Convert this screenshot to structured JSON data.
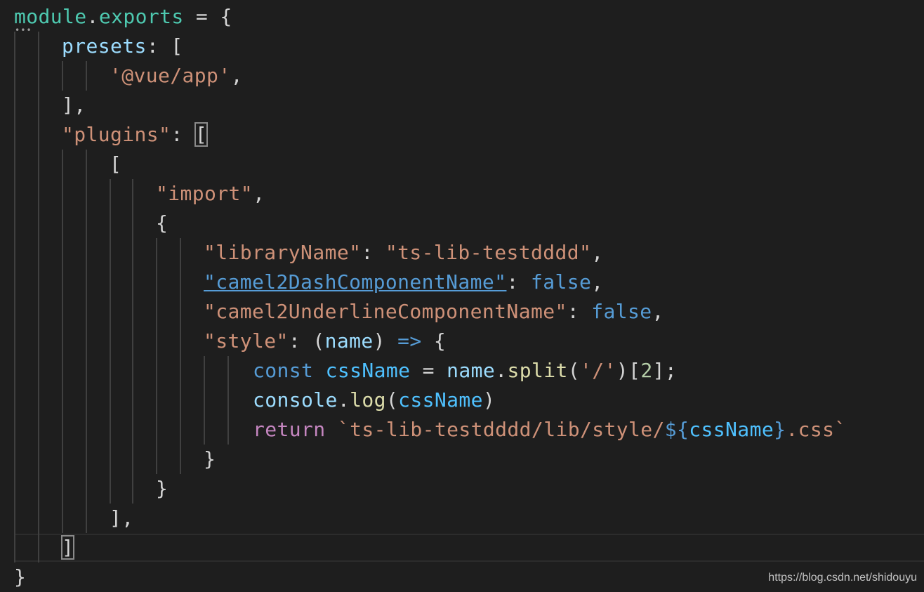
{
  "code_lines": [
    [
      {
        "text": "module",
        "cls": "module"
      },
      {
        "text": ".",
        "cls": "plain"
      },
      {
        "text": "exports",
        "cls": "module"
      },
      {
        "text": " = {",
        "cls": "plain"
      }
    ],
    [
      {
        "text": "presets",
        "cls": "prop"
      },
      {
        "text": ": [",
        "cls": "plain"
      }
    ],
    [
      {
        "text": "'@vue/app'",
        "cls": "string"
      },
      {
        "text": ",",
        "cls": "plain"
      }
    ],
    [
      {
        "text": "],",
        "cls": "plain"
      }
    ],
    [
      {
        "text": "\"plugins\"",
        "cls": "string"
      },
      {
        "text": ": ",
        "cls": "plain"
      },
      {
        "text": "[",
        "cls": "plain bracket-box"
      }
    ],
    [
      {
        "text": "[",
        "cls": "plain"
      }
    ],
    [
      {
        "text": "\"import\"",
        "cls": "string"
      },
      {
        "text": ",",
        "cls": "plain"
      }
    ],
    [
      {
        "text": "{",
        "cls": "plain"
      }
    ],
    [
      {
        "text": "\"libraryName\"",
        "cls": "string"
      },
      {
        "text": ": ",
        "cls": "plain"
      },
      {
        "text": "\"ts-lib-testdddd\"",
        "cls": "string"
      },
      {
        "text": ",",
        "cls": "plain"
      }
    ],
    [
      {
        "text": "\"camel2DashComponentName\"",
        "cls": "link"
      },
      {
        "text": ": ",
        "cls": "plain"
      },
      {
        "text": "false",
        "cls": "bool"
      },
      {
        "text": ",",
        "cls": "plain"
      }
    ],
    [
      {
        "text": "\"camel2UnderlineComponentName\"",
        "cls": "string"
      },
      {
        "text": ": ",
        "cls": "plain"
      },
      {
        "text": "false",
        "cls": "bool"
      },
      {
        "text": ",",
        "cls": "plain"
      }
    ],
    [
      {
        "text": "\"style\"",
        "cls": "string"
      },
      {
        "text": ": (",
        "cls": "plain"
      },
      {
        "text": "name",
        "cls": "var"
      },
      {
        "text": ") ",
        "cls": "plain"
      },
      {
        "text": "=>",
        "cls": "keyword"
      },
      {
        "text": " {",
        "cls": "plain"
      }
    ],
    [
      {
        "text": "const",
        "cls": "keyword"
      },
      {
        "text": " ",
        "cls": "plain"
      },
      {
        "text": "cssName",
        "cls": "bright-var"
      },
      {
        "text": " = ",
        "cls": "plain"
      },
      {
        "text": "name",
        "cls": "var"
      },
      {
        "text": ".",
        "cls": "plain"
      },
      {
        "text": "split",
        "cls": "func"
      },
      {
        "text": "(",
        "cls": "plain"
      },
      {
        "text": "'/'",
        "cls": "string"
      },
      {
        "text": ")[",
        "cls": "plain"
      },
      {
        "text": "2",
        "cls": "number"
      },
      {
        "text": "];",
        "cls": "plain"
      }
    ],
    [
      {
        "text": "console",
        "cls": "var"
      },
      {
        "text": ".",
        "cls": "plain"
      },
      {
        "text": "log",
        "cls": "func"
      },
      {
        "text": "(",
        "cls": "plain"
      },
      {
        "text": "cssName",
        "cls": "bright-var"
      },
      {
        "text": ")",
        "cls": "plain"
      }
    ],
    [
      {
        "text": "return",
        "cls": "return"
      },
      {
        "text": " ",
        "cls": "plain"
      },
      {
        "text": "`ts-lib-testdddd/lib/style/",
        "cls": "template"
      },
      {
        "text": "${",
        "cls": "template-expr"
      },
      {
        "text": "cssName",
        "cls": "bright-var"
      },
      {
        "text": "}",
        "cls": "template-expr"
      },
      {
        "text": ".css`",
        "cls": "template"
      }
    ],
    [
      {
        "text": "}",
        "cls": "plain"
      }
    ],
    [
      {
        "text": "}",
        "cls": "plain"
      }
    ],
    [
      {
        "text": "],",
        "cls": "plain"
      }
    ],
    [
      {
        "text": "]",
        "cls": "plain bracket-box"
      }
    ],
    [
      {
        "text": "}",
        "cls": "plain"
      }
    ]
  ],
  "watermark": "https://blog.csdn.net/shidouyu"
}
